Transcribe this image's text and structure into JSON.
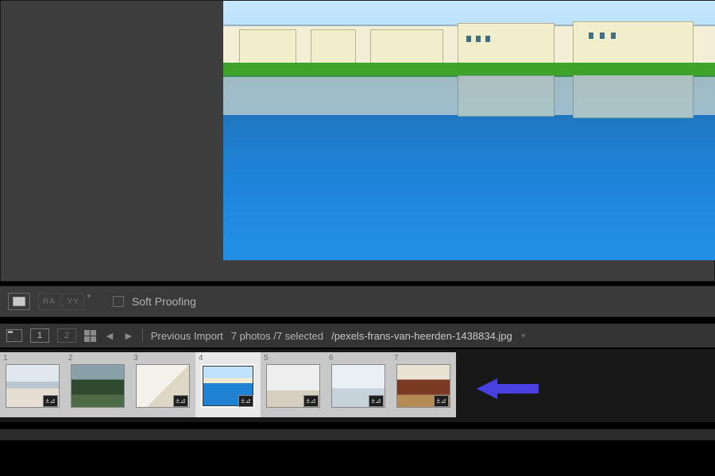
{
  "toolbar": {
    "compare_ra": "RA",
    "compare_yy": "YY",
    "soft_proofing": "Soft Proofing"
  },
  "filmstrip_header": {
    "page_current": "1",
    "page_other": "2",
    "source": "Previous Import",
    "count": "7 photos /7 selected",
    "filename": "/pexels-frans-van-heerden-1438834.jpg"
  },
  "thumbs": [
    {
      "n": "1",
      "badge": "±⊿"
    },
    {
      "n": "2",
      "badge": ""
    },
    {
      "n": "3",
      "badge": "±⊿"
    },
    {
      "n": "4",
      "badge": "±⊿"
    },
    {
      "n": "5",
      "badge": "±⊿"
    },
    {
      "n": "6",
      "badge": "±⊿"
    },
    {
      "n": "7",
      "badge": "±⊿"
    }
  ]
}
